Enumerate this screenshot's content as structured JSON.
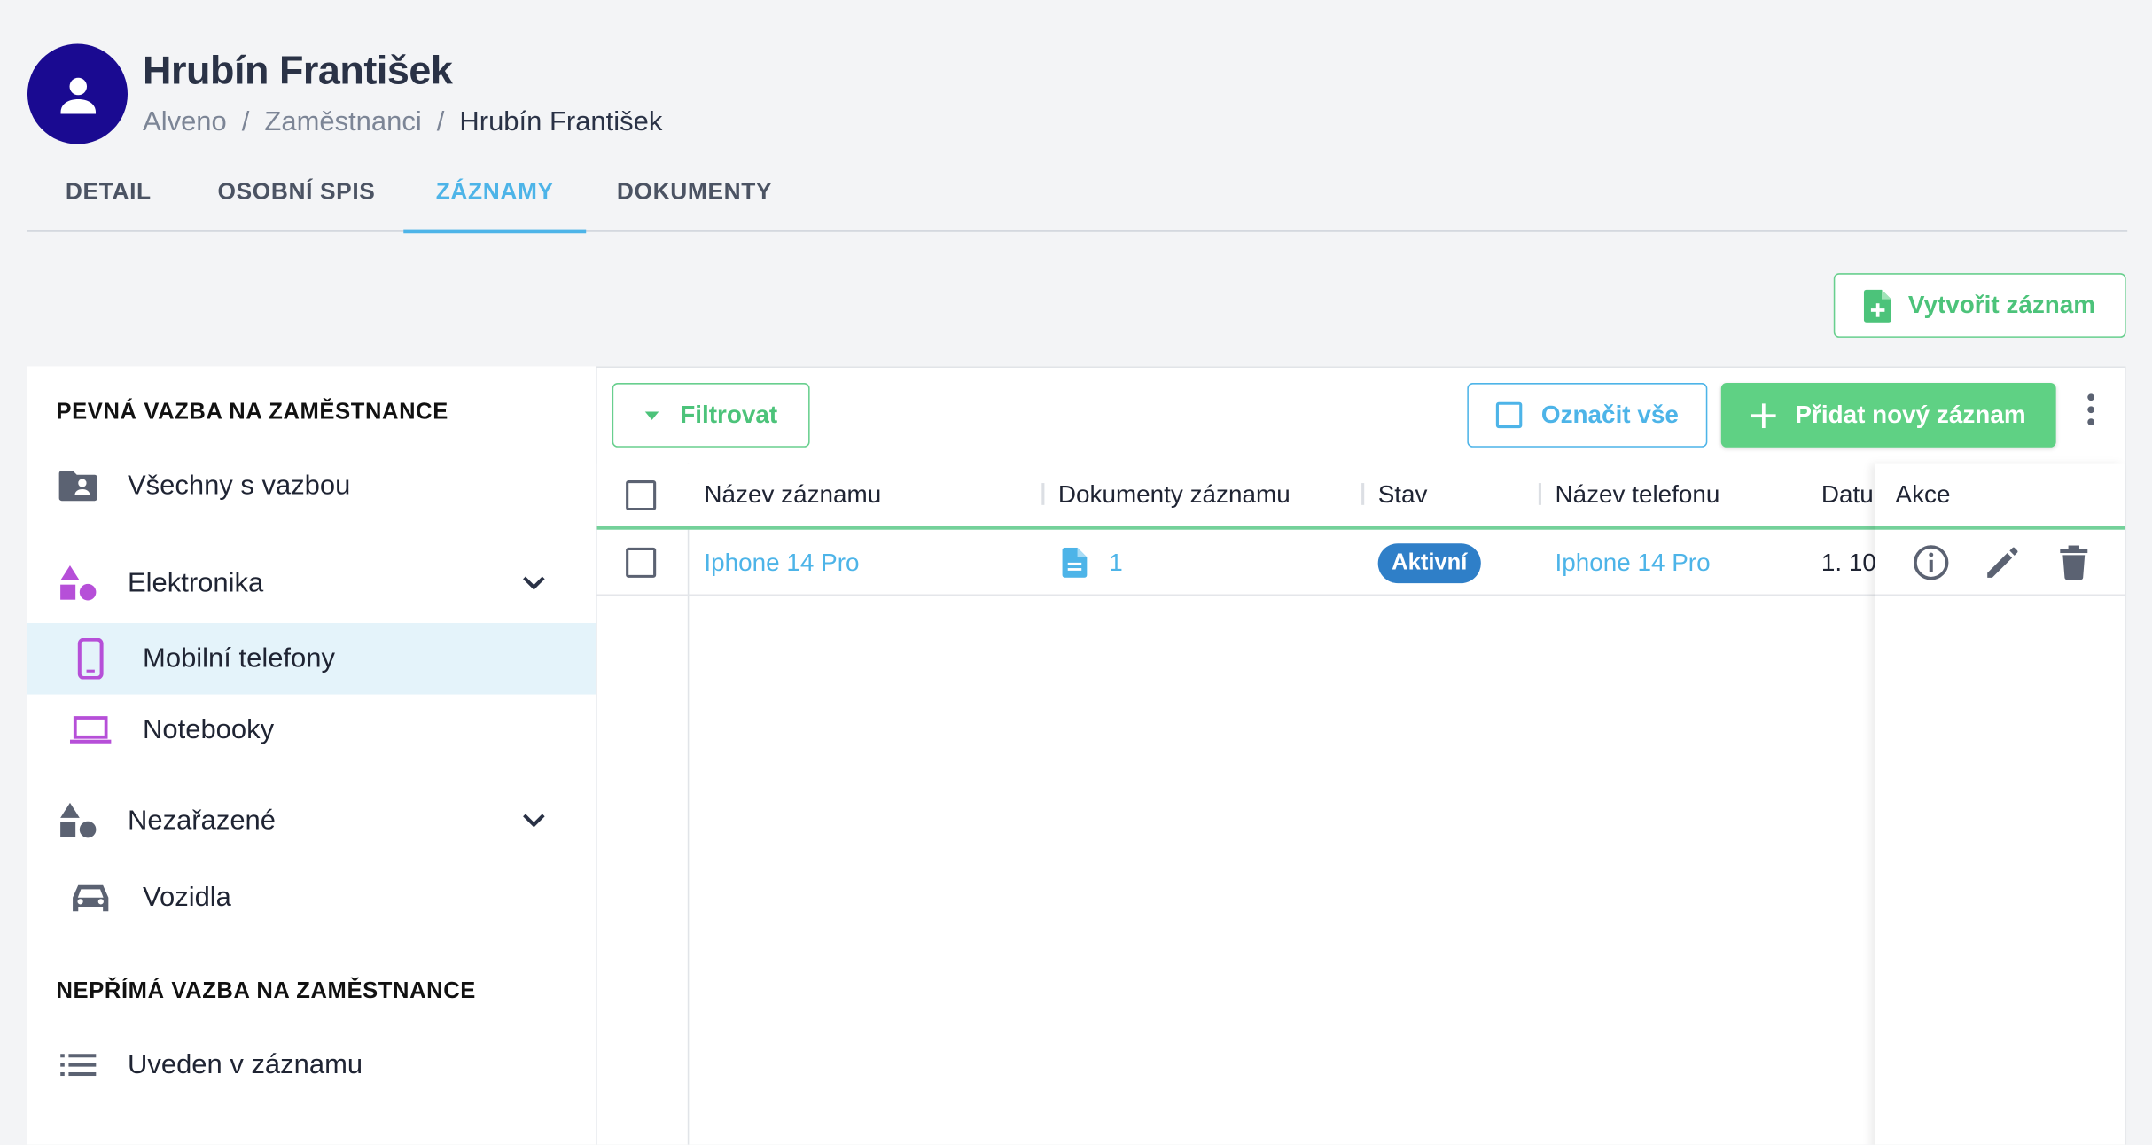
{
  "header": {
    "title": "Hrubín František",
    "breadcrumb": [
      "Alveno",
      "Zaměstnanci",
      "Hrubín František"
    ],
    "separator": "/",
    "avatar_icon": "person-icon",
    "avatar_color": "#1a0a91"
  },
  "tabs": [
    {
      "label": "DETAIL",
      "active": false
    },
    {
      "label": "OSOBNÍ SPIS",
      "active": false
    },
    {
      "label": "ZÁZNAMY",
      "active": true
    },
    {
      "label": "DOKUMENTY",
      "active": false
    }
  ],
  "actions": {
    "create_record": "Vytvořit záznam",
    "filter": "Filtrovat",
    "mark_all": "Označit vše",
    "add_new_record": "Přidat nový záznam"
  },
  "sidebar": {
    "section1": "PEVNÁ VAZBA NA ZAMĚSTNANCE",
    "section2": "NEPŘÍMÁ VAZBA NA ZAMĚSTNANCE",
    "items": [
      {
        "label": "Všechny s vazbou",
        "icon": "folder-person-icon"
      },
      {
        "label": "Elektronika",
        "icon": "shapes-icon",
        "expandable": true
      },
      {
        "label": "Mobilní telefony",
        "icon": "mobile-phone-icon",
        "active": true
      },
      {
        "label": "Notebooky",
        "icon": "laptop-icon"
      },
      {
        "label": "Nezařazené",
        "icon": "shapes-icon",
        "expandable": true
      },
      {
        "label": "Vozidla",
        "icon": "car-icon"
      },
      {
        "label": "Uveden v záznamu",
        "icon": "list-icon"
      }
    ]
  },
  "table": {
    "columns": [
      "Název záznamu",
      "Dokumenty záznamu",
      "Stav",
      "Název telefonu",
      "Datu",
      "Akce"
    ],
    "rows": [
      {
        "name": "Iphone 14 Pro",
        "documents": "1",
        "status": "Aktivní",
        "phone_name": "Iphone 14 Pro",
        "date": "1. 10."
      }
    ]
  },
  "colors": {
    "accent_blue": "#4db4e8",
    "accent_green": "#5fd184",
    "status_active": "#2f7fc8",
    "category_icon": "#b64fd8"
  }
}
